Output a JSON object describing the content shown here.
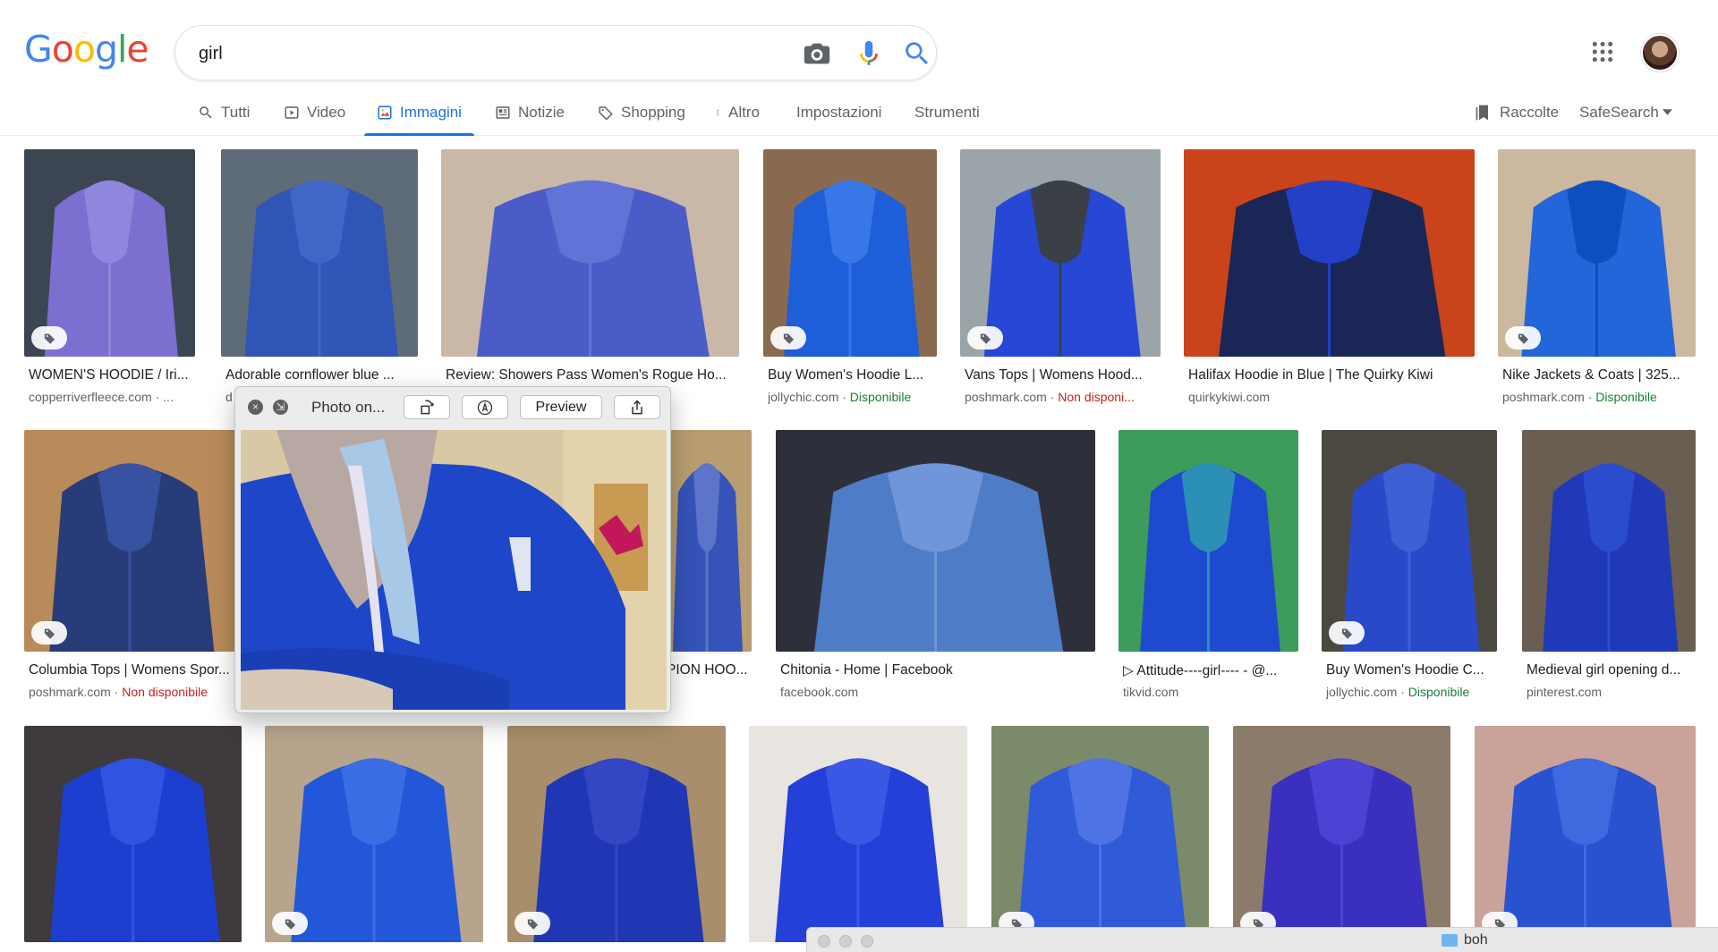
{
  "header": {
    "logo_letters": [
      {
        "ch": "G",
        "color": "#4285F4"
      },
      {
        "ch": "o",
        "color": "#EA4335"
      },
      {
        "ch": "o",
        "color": "#FBBC05"
      },
      {
        "ch": "g",
        "color": "#4285F4"
      },
      {
        "ch": "l",
        "color": "#34A853"
      },
      {
        "ch": "e",
        "color": "#EA4335"
      }
    ],
    "search_query": "girl",
    "icons": [
      "camera-icon",
      "microphone-icon",
      "search-icon",
      "apps-grid-icon"
    ]
  },
  "tabs": {
    "all": "Tutti",
    "video": "Video",
    "images": "Immagini",
    "news": "Notizie",
    "shopping": "Shopping",
    "more": "Altro",
    "settings": "Impostazioni",
    "tools": "Strumenti",
    "active": "Immagini",
    "collections": "Raccolte",
    "safesearch": "SafeSearch"
  },
  "colors": {
    "accent": "#1a73e8",
    "available": "#188038",
    "unavailable": "#c5221f"
  },
  "results": [
    {
      "caption": "WOMEN'S HOODIE / Iri...",
      "source": "copperriverfleece.com · ...",
      "status": "",
      "badge": true
    },
    {
      "caption": "Adorable cornflower blue ...",
      "source": "d",
      "status": "",
      "badge": false
    },
    {
      "caption": "Review: Showers Pass Women's Rogue Ho...",
      "source": "",
      "status": "",
      "badge": false
    },
    {
      "caption": "Buy Women's Hoodie L...",
      "source": "jollychic.com · ",
      "status": "Disponibile",
      "badge": true
    },
    {
      "caption": "Vans Tops | Womens Hood...",
      "source": "poshmark.com · ",
      "status": "Non disponi...",
      "badge": true
    },
    {
      "caption": "Halifax Hoodie in Blue | The Quirky Kiwi",
      "source": "quirkykiwi.com",
      "status": "",
      "badge": false
    },
    {
      "caption": "Nike Jackets & Coats | 325...",
      "source": "poshmark.com · ",
      "status": "Disponibile",
      "badge": true
    },
    {
      "caption": "Columbia Tops | Womens Spor...",
      "source": "poshmark.com · ",
      "status": "Non disponibile",
      "badge": true
    },
    {
      "caption": "PION HOO...",
      "source": "",
      "status": "",
      "badge": false
    },
    {
      "caption": "Chitonia - Home | Facebook",
      "source": "facebook.com",
      "status": "",
      "badge": false
    },
    {
      "caption": "▷ Attitude----girl---- - @...",
      "source": "tikvid.com",
      "status": "",
      "badge": false
    },
    {
      "caption": "Buy Women's Hoodie C...",
      "source": "jollychic.com · ",
      "status": "Disponibile",
      "badge": true
    },
    {
      "caption": "Medieval girl opening d...",
      "source": "pinterest.com",
      "status": "",
      "badge": false
    },
    {
      "caption": "",
      "source": "",
      "status": "",
      "badge": false
    },
    {
      "caption": "",
      "source": "",
      "status": "",
      "badge": true
    },
    {
      "caption": "",
      "source": "",
      "status": "",
      "badge": true
    },
    {
      "caption": "",
      "source": "",
      "status": "",
      "badge": false
    },
    {
      "caption": "",
      "source": "",
      "status": "",
      "badge": true
    },
    {
      "caption": "",
      "source": "",
      "status": "",
      "badge": true
    },
    {
      "caption": "",
      "source": "",
      "status": "",
      "badge": true
    }
  ],
  "preview_window": {
    "title": "Photo on...",
    "preview_button": "Preview",
    "icons": [
      "close-icon",
      "fullscreen-icon",
      "rotate-icon",
      "markup-icon",
      "share-icon"
    ]
  },
  "finder_bar": {
    "label": "boh"
  }
}
